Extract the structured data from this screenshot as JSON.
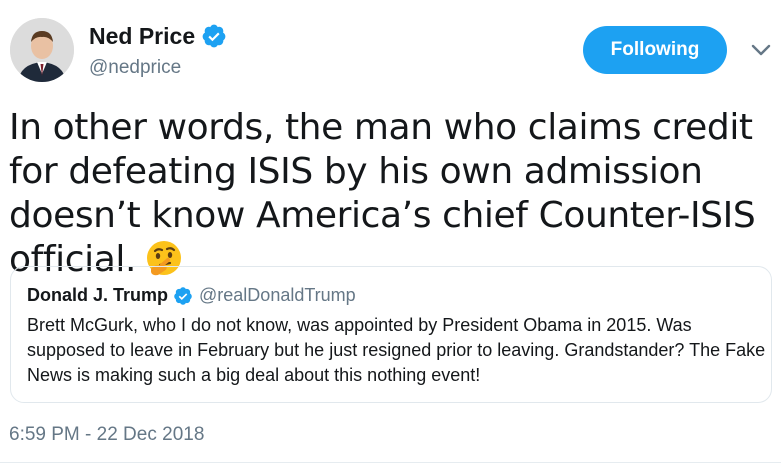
{
  "author": {
    "name": "Ned Price",
    "handle": "@nedprice",
    "verified_icon": "verified-badge-icon"
  },
  "actions": {
    "follow_label": "Following",
    "menu_icon": "chevron-down-icon"
  },
  "tweet": {
    "text": "In other words, the man who claims credit for defeating ISIS by his own admission doesn’t know America’s chief Counter-ISIS official.",
    "emoji": "thinking-face-icon",
    "timestamp": "6:59 PM - 22 Dec 2018"
  },
  "quoted_tweet": {
    "name": "Donald J. Trump",
    "handle": "@realDonaldTrump",
    "text": "Brett McGurk, who I do not know, was appointed by President Obama in 2015. Was supposed to leave in February but he just resigned prior to leaving. Grandstander? The Fake News is making such a big deal about this nothing event!"
  },
  "colors": {
    "accent": "#1da1f2",
    "text": "#14171a",
    "muted": "#657786",
    "border": "#e1e8ed"
  }
}
